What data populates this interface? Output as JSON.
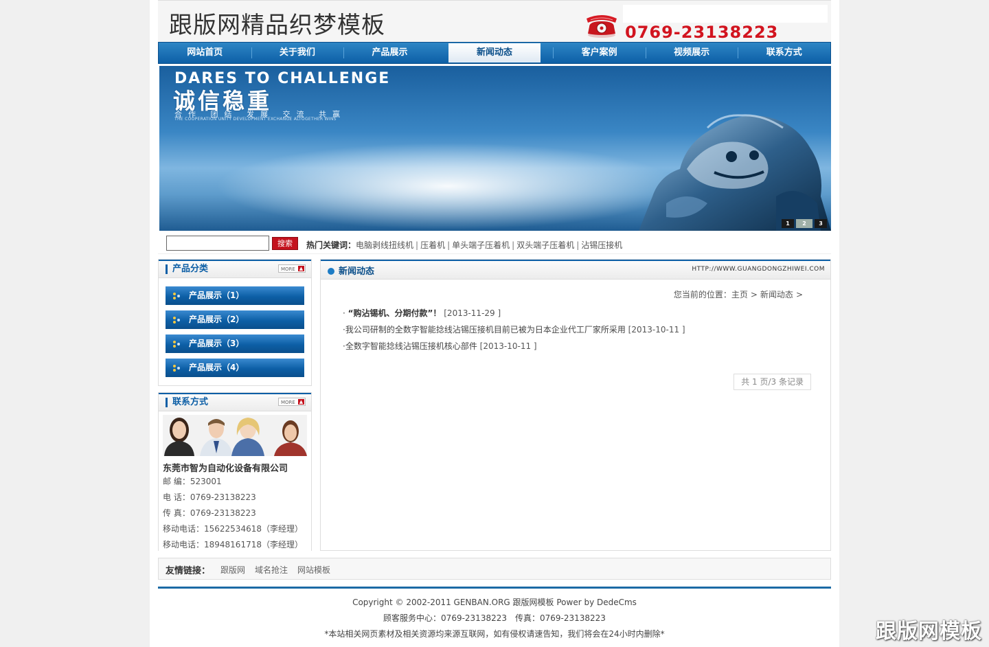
{
  "header": {
    "site_title": "跟版网精品织梦模板",
    "phone": "0769-23138223"
  },
  "nav": {
    "items": [
      {
        "label": "网站首页"
      },
      {
        "label": "关于我们"
      },
      {
        "label": "产品展示"
      },
      {
        "label": "新闻动态",
        "active": true
      },
      {
        "label": "客户案例"
      },
      {
        "label": "视频展示"
      },
      {
        "label": "联系方式"
      }
    ]
  },
  "banner": {
    "headline_en": "DARES TO CHALLENGE",
    "headline_cn": "诚信稳重",
    "subline_cn": "合作 团结 发展 交流 共赢",
    "subline_en": "THE COOPERATION UNITY DEVELOPMENT EXCHANGE ALTOGETHER WINS",
    "slides": [
      "1",
      "2",
      "3"
    ],
    "active_slide": 2
  },
  "search": {
    "input_value": "",
    "button_label": "搜索",
    "hot_label": "热门关键词：",
    "hot_keywords": [
      "电脑剥线扭线机",
      "压着机",
      "单头端子压着机",
      "双头端子压着机",
      "沾锡压接机"
    ]
  },
  "sidebar": {
    "categories": {
      "title": "产品分类",
      "more": "MORE",
      "items": [
        "产品展示（1）",
        "产品展示（2）",
        "产品展示（3）",
        "产品展示（4）"
      ]
    },
    "contact": {
      "title": "联系方式",
      "more": "MORE",
      "company": "东莞市智为自动化设备有限公司",
      "lines": [
        "邮 编：523001",
        "电 话：0769-23138223",
        "传 真：0769-23138223",
        "移动电话：15622534618（李经理）",
        "移动电话：18948161718（李经理）"
      ]
    }
  },
  "main": {
    "title": "新闻动态",
    "url": "HTTP://WWW.GUANGDONGZHIWEI.COM",
    "breadcrumb": {
      "prefix": "您当前的位置：",
      "items": [
        "主页",
        "新闻动态"
      ]
    },
    "news": [
      {
        "title": "“购沾锡机、分期付款”！",
        "date": "[2013-11-29 ]",
        "bold": true
      },
      {
        "title": "我公司研制的全数字智能捻线沾锡压接机目前已被为日本企业代工厂家所采用",
        "date": "[2013-10-11 ]",
        "bold": false
      },
      {
        "title": "全数字智能捻线沾锡压接机核心部件",
        "date": "[2013-10-11 ]",
        "bold": false
      }
    ],
    "pager": "共 1 页/3 条记录"
  },
  "friend_links": {
    "label": "友情链接：",
    "items": [
      "跟版网",
      "域名抢注",
      "网站模板"
    ]
  },
  "footer": {
    "copyright": "Copyright © 2002-2011 GENBAN.ORG 跟版网模板 Power by DedeCms",
    "service": "顾客服务中心：0769-23138223　传真：0769-23138223",
    "notice": "*本站相关网页素材及相关资源均来源互联网，如有侵权请速告知，我们将会在24小时内删除*"
  },
  "watermark": "跟版网模板",
  "colors": {
    "brand_blue": "#0d5fa6",
    "phone_red": "#d2141f",
    "button_red": "#c4121d"
  }
}
